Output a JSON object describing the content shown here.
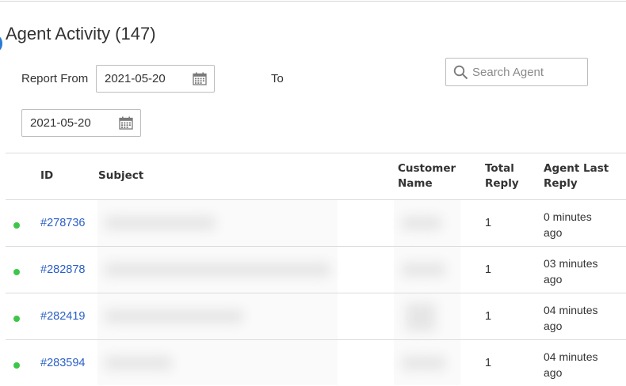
{
  "page": {
    "title": "Agent Activity (147)"
  },
  "filters": {
    "report_from_label": "Report From",
    "from_date": "2021-05-20",
    "to_label": "To",
    "to_date": "2021-05-20",
    "search_placeholder": "Search Agent"
  },
  "table": {
    "headers": {
      "id": "ID",
      "subject": "Subject",
      "customer_line1": "Customer",
      "customer_line2": "Name",
      "total_line1": "Total",
      "total_line2": "Reply",
      "last_line1": "Agent Last",
      "last_line2": "Reply"
    },
    "rows": [
      {
        "id": "#278736",
        "total_reply": "1",
        "last_line1": "0 minutes",
        "last_line2": "ago",
        "status_color": "#3ec64a"
      },
      {
        "id": "#282878",
        "total_reply": "1",
        "last_line1": "03 minutes",
        "last_line2": "ago",
        "status_color": "#3ec64a"
      },
      {
        "id": "#282419",
        "total_reply": "1",
        "last_line1": "04 minutes",
        "last_line2": "ago",
        "status_color": "#3ec64a"
      },
      {
        "id": "#283594",
        "total_reply": "1",
        "last_line1": "04 minutes",
        "last_line2": "ago",
        "status_color": "#3ec64a"
      }
    ]
  },
  "icons": {
    "date_picker": "calendar-icon",
    "search": "search-icon",
    "status": "status-dot"
  },
  "colors": {
    "link": "#2a5fc7",
    "status_online": "#3ec64a",
    "border": "#bdbdbd"
  }
}
